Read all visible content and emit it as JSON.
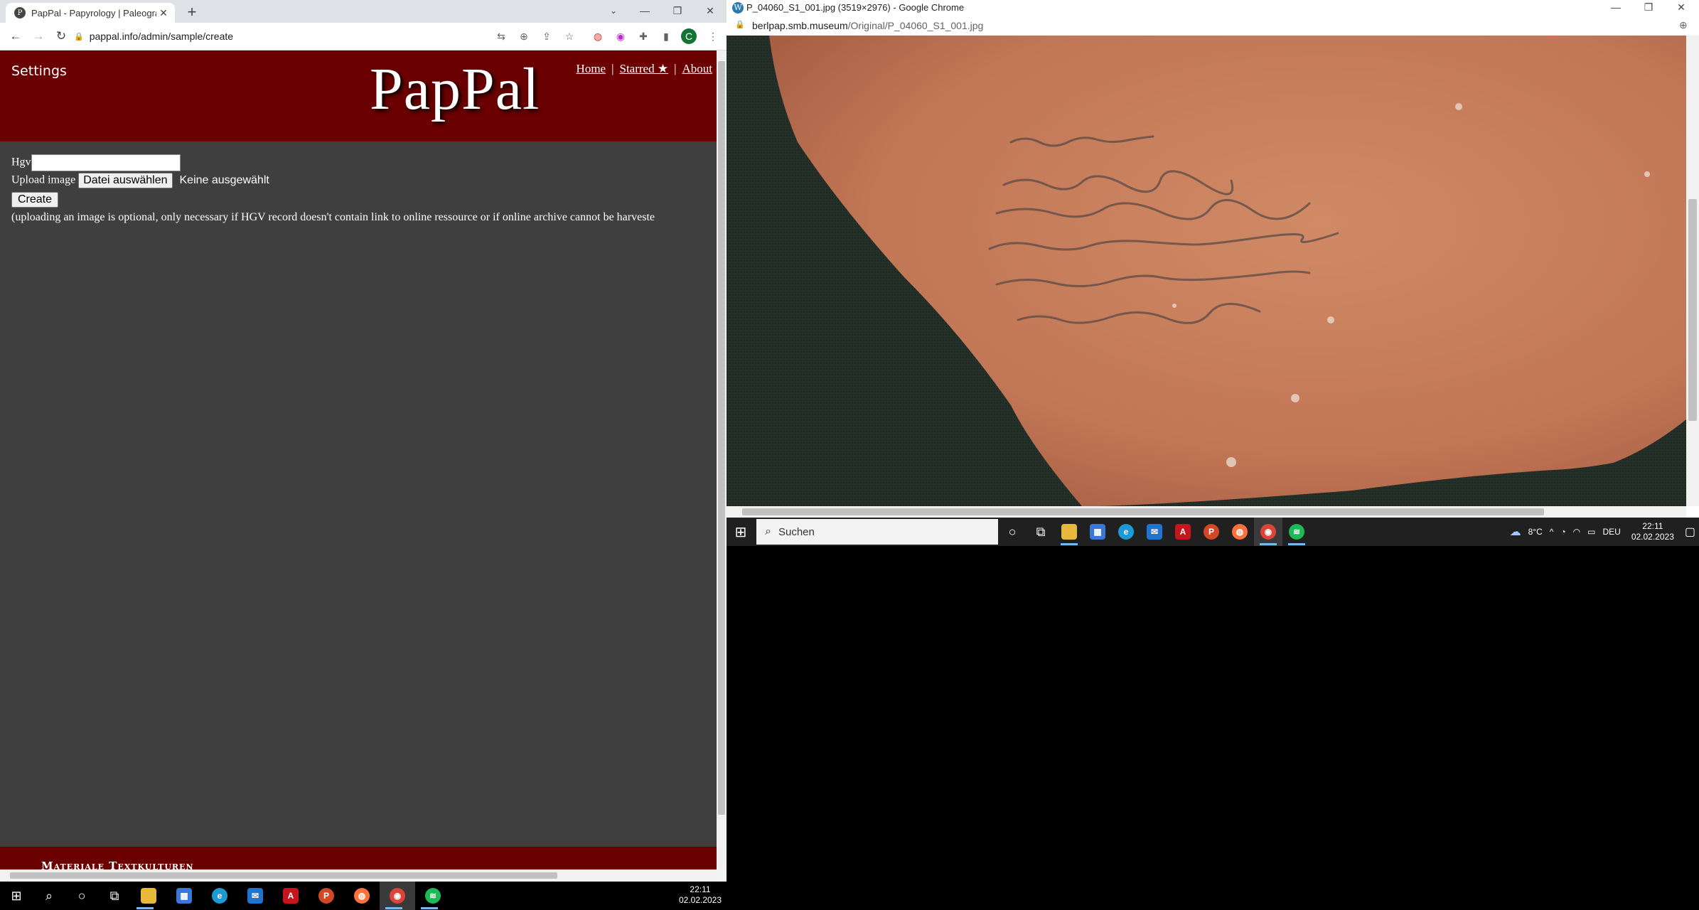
{
  "left_window": {
    "tab_title": "PapPal - Papyrology | Paleography",
    "url": "pappal.info/admin/sample/create",
    "page": {
      "settings_label": "Settings",
      "logo_text": "PapPal",
      "nav": {
        "home": "Home",
        "starred": "Starred ★",
        "about": "About",
        "separator": "|"
      },
      "form": {
        "hgv_label": "Hgv",
        "upload_label": "Upload image",
        "file_button": "Datei auswählen",
        "file_status": "Keine ausgewählt",
        "create_button": "Create",
        "note": "(uploading an image is optional, only necessary if HGV record doesn't contain link to online ressource or if online archive cannot be harveste"
      },
      "footer_text": "Materiale Textkulturen"
    },
    "profile_initial": "C"
  },
  "right_window": {
    "title": "P_04060_S1_001.jpg (3519×2976) - Google Chrome",
    "url_domain": "berlpap.smb.museum",
    "url_path": "/Original/P_04060_S1_001.jpg"
  },
  "taskbar_right": {
    "search_placeholder": "Suchen",
    "weather": "8°C",
    "lang": "DEU",
    "time": "22:11",
    "date": "02.02.2023"
  },
  "taskbar_main": {
    "time": "22:11",
    "date": "02.02.2023"
  },
  "colors": {
    "header_red": "#6b0000",
    "page_bg": "#3f3f3f",
    "shard": "#c47a5a",
    "cloth": "#243028"
  }
}
